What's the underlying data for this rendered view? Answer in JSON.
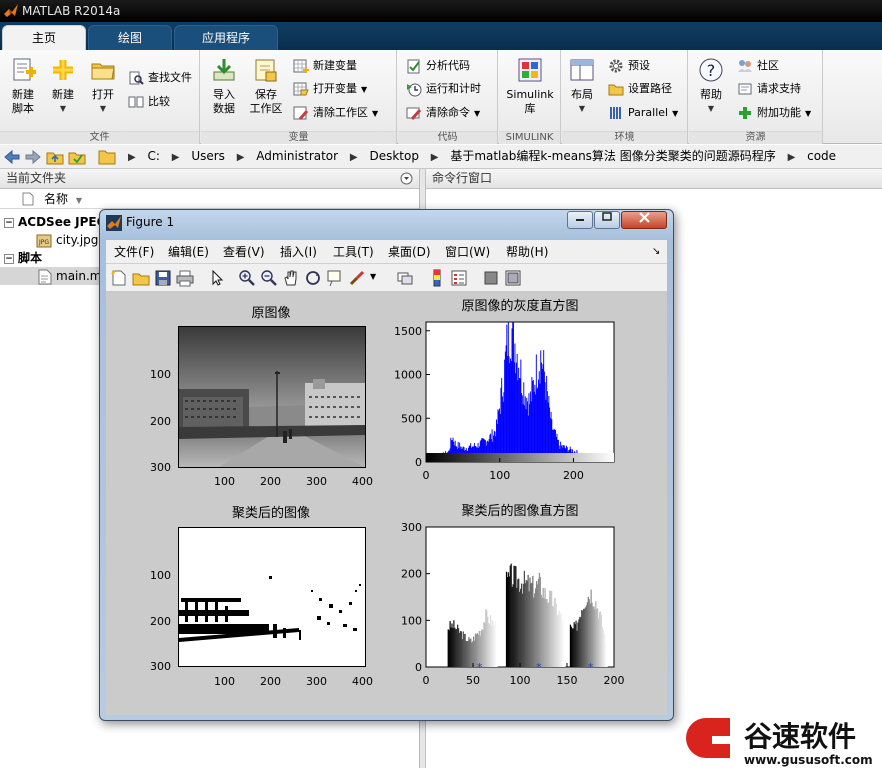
{
  "app": {
    "title": "MATLAB R2014a"
  },
  "tabs": [
    {
      "label": "主页",
      "active": true
    },
    {
      "label": "绘图",
      "active": false
    },
    {
      "label": "应用程序",
      "active": false
    }
  ],
  "ribbon": {
    "file_group": {
      "label": "文件",
      "new_script": [
        "新建",
        "脚本"
      ],
      "new": "新建",
      "open": "打开",
      "find_files": "查找文件",
      "compare": "比较"
    },
    "variable_group": {
      "label": "变量",
      "import_data": [
        "导入",
        "数据"
      ],
      "save_workspace": [
        "保存",
        "工作区"
      ],
      "new_variable": "新建变量",
      "open_variable": "打开变量",
      "clear_workspace": "清除工作区"
    },
    "code_group": {
      "label": "代码",
      "analyze_code": "分析代码",
      "run_and_time": "运行和计时",
      "clear_commands": "清除命令"
    },
    "simulink_group": {
      "label": "SIMULINK",
      "simulink_library": [
        "Simulink",
        "库"
      ]
    },
    "environment_group": {
      "label": "环境",
      "layout": "布局",
      "preferences": "预设",
      "set_path": "设置路径",
      "parallel": "Parallel"
    },
    "resources_group": {
      "label": "资源",
      "help": "帮助",
      "community": "社区",
      "request_support": "请求支持",
      "add_ons": "附加功能"
    }
  },
  "address": {
    "crumbs": [
      "C:",
      "Users",
      "Administrator",
      "Desktop",
      "基于matlab编程k-means算法 图像分类聚类的问题源码程序",
      "code"
    ]
  },
  "current_folder": {
    "title": "当前文件夹",
    "column_name": "名称",
    "items": [
      {
        "label": "ACDSee JPEG",
        "bold": true
      },
      {
        "label": "city.jpg",
        "bold": false
      },
      {
        "label": "脚本",
        "bold": true
      },
      {
        "label": "main.m",
        "bold": false
      }
    ]
  },
  "command_window": {
    "title": "命令行窗口"
  },
  "figure": {
    "title": "Figure 1",
    "menus": [
      "文件(F)",
      "编辑(E)",
      "查看(V)",
      "插入(I)",
      "工具(T)",
      "桌面(D)",
      "窗口(W)",
      "帮助(H)"
    ],
    "subplots": {
      "original_title": "原图像",
      "orig_hist_title": "原图像的灰度直方图",
      "clustered_title": "聚类后的图像",
      "clust_hist_title": "聚类后的图像直方图"
    },
    "image_yticks": [
      "100",
      "200",
      "300"
    ],
    "image_xticks": [
      "100",
      "200",
      "300",
      "400"
    ]
  },
  "chart_data": [
    {
      "type": "bar",
      "title": "原图像的灰度直方图",
      "xlim": [
        0,
        255
      ],
      "ylim": [
        0,
        1600
      ],
      "xticks": [
        0,
        100,
        200
      ],
      "yticks": [
        0,
        500,
        1000,
        1500
      ],
      "color": "#0000ff",
      "series": [
        {
          "x": [
            0,
            10,
            20,
            30,
            35,
            40,
            45,
            50,
            60,
            70,
            80,
            90,
            95,
            100,
            105,
            110,
            115,
            120,
            125,
            130,
            135,
            140,
            145,
            150,
            155,
            160,
            165,
            170,
            180,
            190,
            200,
            210,
            220,
            230,
            240,
            250
          ],
          "values": [
            0,
            30,
            80,
            120,
            300,
            200,
            190,
            160,
            180,
            200,
            250,
            320,
            400,
            700,
            1000,
            1450,
            1580,
            1400,
            1200,
            950,
            780,
            700,
            900,
            1100,
            1250,
            1050,
            700,
            420,
            200,
            160,
            130,
            90,
            60,
            30,
            10,
            0
          ]
        }
      ]
    },
    {
      "type": "bar",
      "title": "聚类后的图像直方图",
      "xlim": [
        0,
        200
      ],
      "ylim": [
        0,
        300
      ],
      "xticks": [
        0,
        50,
        100,
        150,
        200
      ],
      "yticks": [
        0,
        100,
        200,
        300
      ],
      "centers": [
        57,
        120,
        175
      ],
      "series": [
        {
          "x": [
            23,
            28,
            33,
            38,
            43,
            48,
            53,
            58,
            63,
            68,
            73,
            85,
            90,
            95,
            100,
            105,
            110,
            115,
            120,
            125,
            130,
            135,
            140,
            145,
            155,
            160,
            165,
            170,
            175,
            180,
            185,
            190
          ],
          "values": [
            85,
            90,
            80,
            70,
            60,
            55,
            70,
            80,
            110,
            100,
            90,
            180,
            195,
            190,
            185,
            180,
            175,
            170,
            180,
            160,
            150,
            140,
            120,
            100,
            80,
            90,
            130,
            150,
            160,
            140,
            110,
            60
          ]
        }
      ]
    }
  ]
}
